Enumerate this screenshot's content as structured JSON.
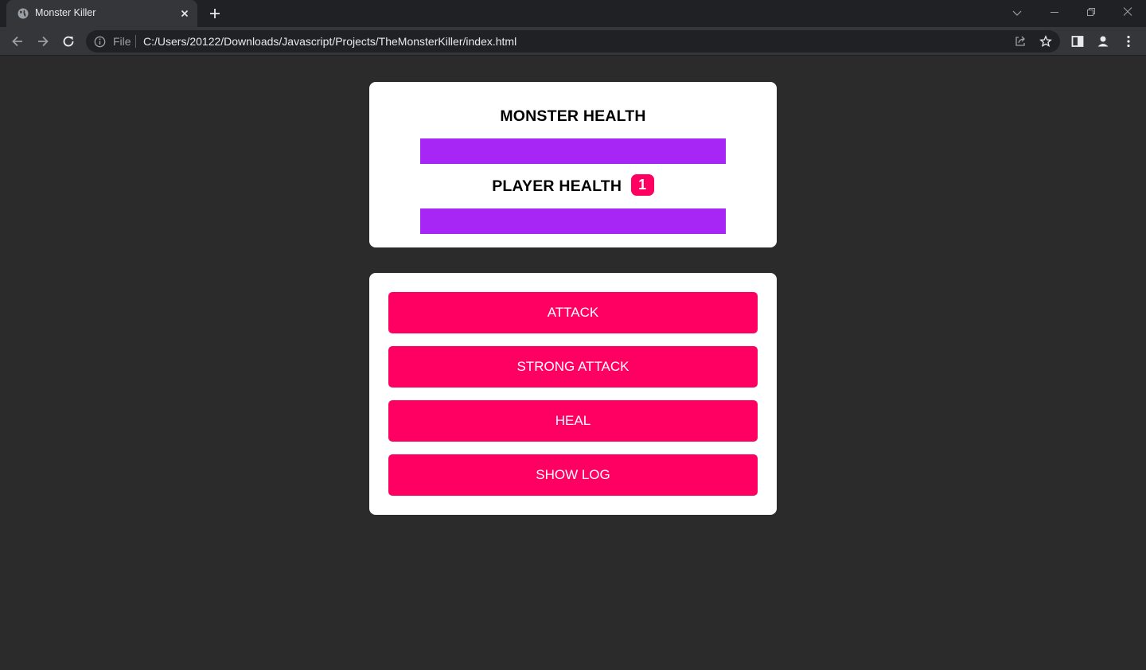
{
  "browser": {
    "tab_title": "Monster Killer",
    "file_label": "File",
    "url": "C:/Users/20122/Downloads/Javascript/Projects/TheMonsterKiller/index.html",
    "icons": [
      "globe-icon",
      "close-icon",
      "plus-icon",
      "chevron-down-icon",
      "minimize-icon",
      "restore-icon",
      "close-window-icon",
      "back-arrow-icon",
      "forward-arrow-icon",
      "reload-icon",
      "info-icon",
      "share-icon",
      "star-icon",
      "sidebar-icon",
      "profile-icon",
      "kebab-menu-icon"
    ]
  },
  "health": {
    "monster_label": "MONSTER HEALTH",
    "monster_value": 100,
    "player_label": "PLAYER HEALTH",
    "bonus_lives": "1",
    "player_value": 100
  },
  "controls": {
    "attack": "ATTACK",
    "strong_attack": "STRONG ATTACK",
    "heal": "HEAL",
    "show_log": "SHOW LOG"
  },
  "colors": {
    "page_bg": "#2b2b2b",
    "bar_fill": "#a726f6",
    "button": "#ff0062",
    "card": "#ffffff"
  }
}
